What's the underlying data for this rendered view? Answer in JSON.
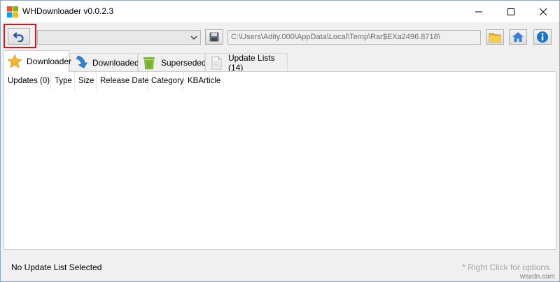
{
  "window": {
    "title": "WHDownloader v0.0.2.3"
  },
  "toolbar": {
    "combo_value": "",
    "path_value": "C:\\Users\\Adity.000\\AppData\\Local\\Temp\\Rar$EXa2496.8718\\",
    "icons": [
      "undo-icon",
      "save-icon",
      "folder-icon",
      "home-icon",
      "info-icon"
    ],
    "highlight_color": "#d0191e"
  },
  "tabs": [
    {
      "label": "Downloader",
      "icon": "star-icon",
      "active": true
    },
    {
      "label": "Downloaded",
      "icon": "download-arrow-icon",
      "active": false
    },
    {
      "label": "Superseded",
      "icon": "trash-icon",
      "active": false
    },
    {
      "label": "Update Lists (14)",
      "icon": "document-icon",
      "active": false
    }
  ],
  "list": {
    "columns": [
      "Updates (0)",
      "Type",
      "Size",
      "Release Date",
      "Category",
      "KBArticle"
    ],
    "rows": []
  },
  "status": {
    "left": "No Update List Selected",
    "right": "* Right Click for options"
  },
  "watermark": "wsxdn.com"
}
